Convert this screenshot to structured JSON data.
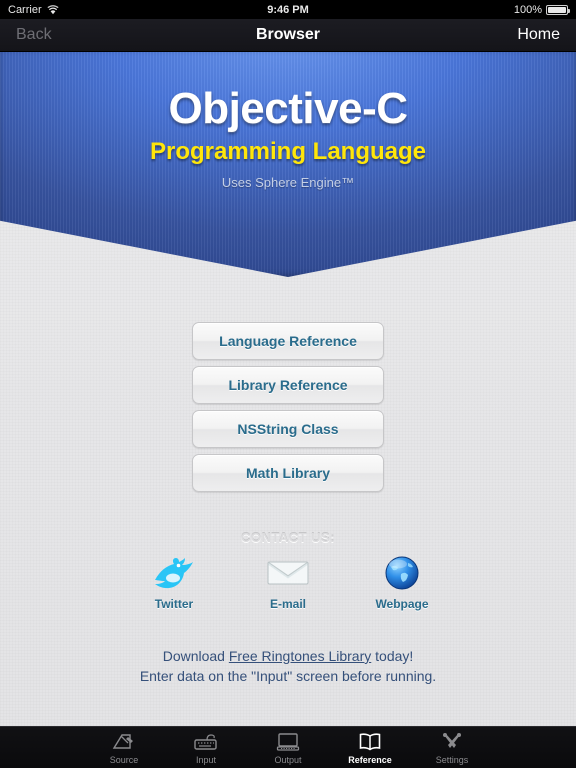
{
  "status_bar": {
    "carrier": "Carrier",
    "wifi_icon": "wifi-icon",
    "time": "9:46 PM",
    "battery_percent": "100%",
    "battery_icon": "battery-full-icon"
  },
  "nav_bar": {
    "back_label": "Back",
    "title": "Browser",
    "home_label": "Home"
  },
  "banner": {
    "title": "Objective-C",
    "subtitle": "Programming Language",
    "tagline": "Uses Sphere Engine™",
    "color_top": "#6a97ef",
    "color_bottom": "#2c448c",
    "title_color": "#ffffff",
    "subtitle_color": "#ffe60a"
  },
  "reference_buttons": [
    {
      "label": "Language Reference"
    },
    {
      "label": "Library Reference"
    },
    {
      "label": "NSString Class"
    },
    {
      "label": "Math Library"
    }
  ],
  "contact": {
    "heading": "CONTACT US:",
    "items": [
      {
        "label": "Twitter",
        "icon": "twitter-bird-icon"
      },
      {
        "label": "E-mail",
        "icon": "envelope-icon"
      },
      {
        "label": "Webpage",
        "icon": "globe-icon"
      }
    ]
  },
  "footer": {
    "line1_before": "Download ",
    "line1_link": "Free Ringtones Library",
    "line1_after": " today!",
    "line2": "Enter data on the \"Input\" screen before running."
  },
  "tab_bar": {
    "items": [
      {
        "label": "Source",
        "icon": "pen-paper-icon",
        "active": false
      },
      {
        "label": "Input",
        "icon": "keyboard-icon",
        "active": false
      },
      {
        "label": "Output",
        "icon": "monitor-icon",
        "active": false
      },
      {
        "label": "Reference",
        "icon": "open-book-icon",
        "active": true
      },
      {
        "label": "Settings",
        "icon": "tools-icon",
        "active": false
      }
    ]
  },
  "theme": {
    "accent_blue": "#2a6c8c",
    "link_blue": "#35507a",
    "background": "#e9e9eb"
  }
}
